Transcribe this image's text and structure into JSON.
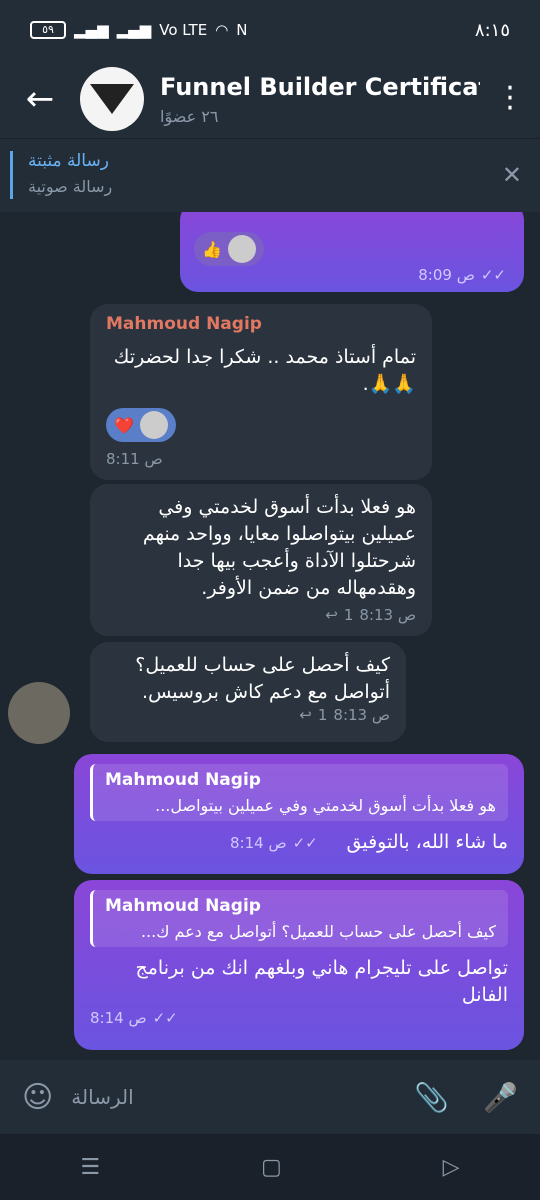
{
  "status": {
    "battery": "٥٩",
    "network": "Vo LTE",
    "time": "٨:١٥"
  },
  "header": {
    "title": "Funnel Builder Certificat",
    "subtitle": "٢٦ عضوًا"
  },
  "pinned": {
    "title": "رسالة مثبتة",
    "text": "رسالة صوتية"
  },
  "messages": [
    {
      "time": "8:09 ص"
    },
    {
      "sender": "Mahmoud Nagip",
      "text": "تمام أستاذ محمد .. شكرا جدا لحضرتك 🙏🙏.",
      "time": "8:11 ص"
    },
    {
      "text": "هو فعلا بدأت أسوق لخدمتي وفي عميلين بيتواصلوا معايا، وواحد منهم شرحتلوا الآداة وأعجب بيها جدا وهقدمهاله من ضمن الأوفر.",
      "time": "8:13 ص",
      "replies": "1"
    },
    {
      "text": "كيف أحصل على حساب للعميل؟ أتواصل مع دعم كاش بروسيس.",
      "time": "8:13 ص",
      "replies": "1"
    },
    {
      "reply_name": "Mahmoud Nagip",
      "reply_text": "هو فعلا بدأت أسوق لخدمتي وفي عميلين بيتواصل...",
      "text": "ما شاء الله، بالتوفيق",
      "time": "8:14 ص"
    },
    {
      "reply_name": "Mahmoud Nagip",
      "reply_text": "كيف أحصل على حساب للعميل؟ أتواصل مع دعم ك...",
      "text": "تواصل على تليجرام هاني وبلغهم انك من برنامج الفانل",
      "time": "8:14 ص"
    }
  ],
  "input": {
    "placeholder": "الرسالة"
  }
}
